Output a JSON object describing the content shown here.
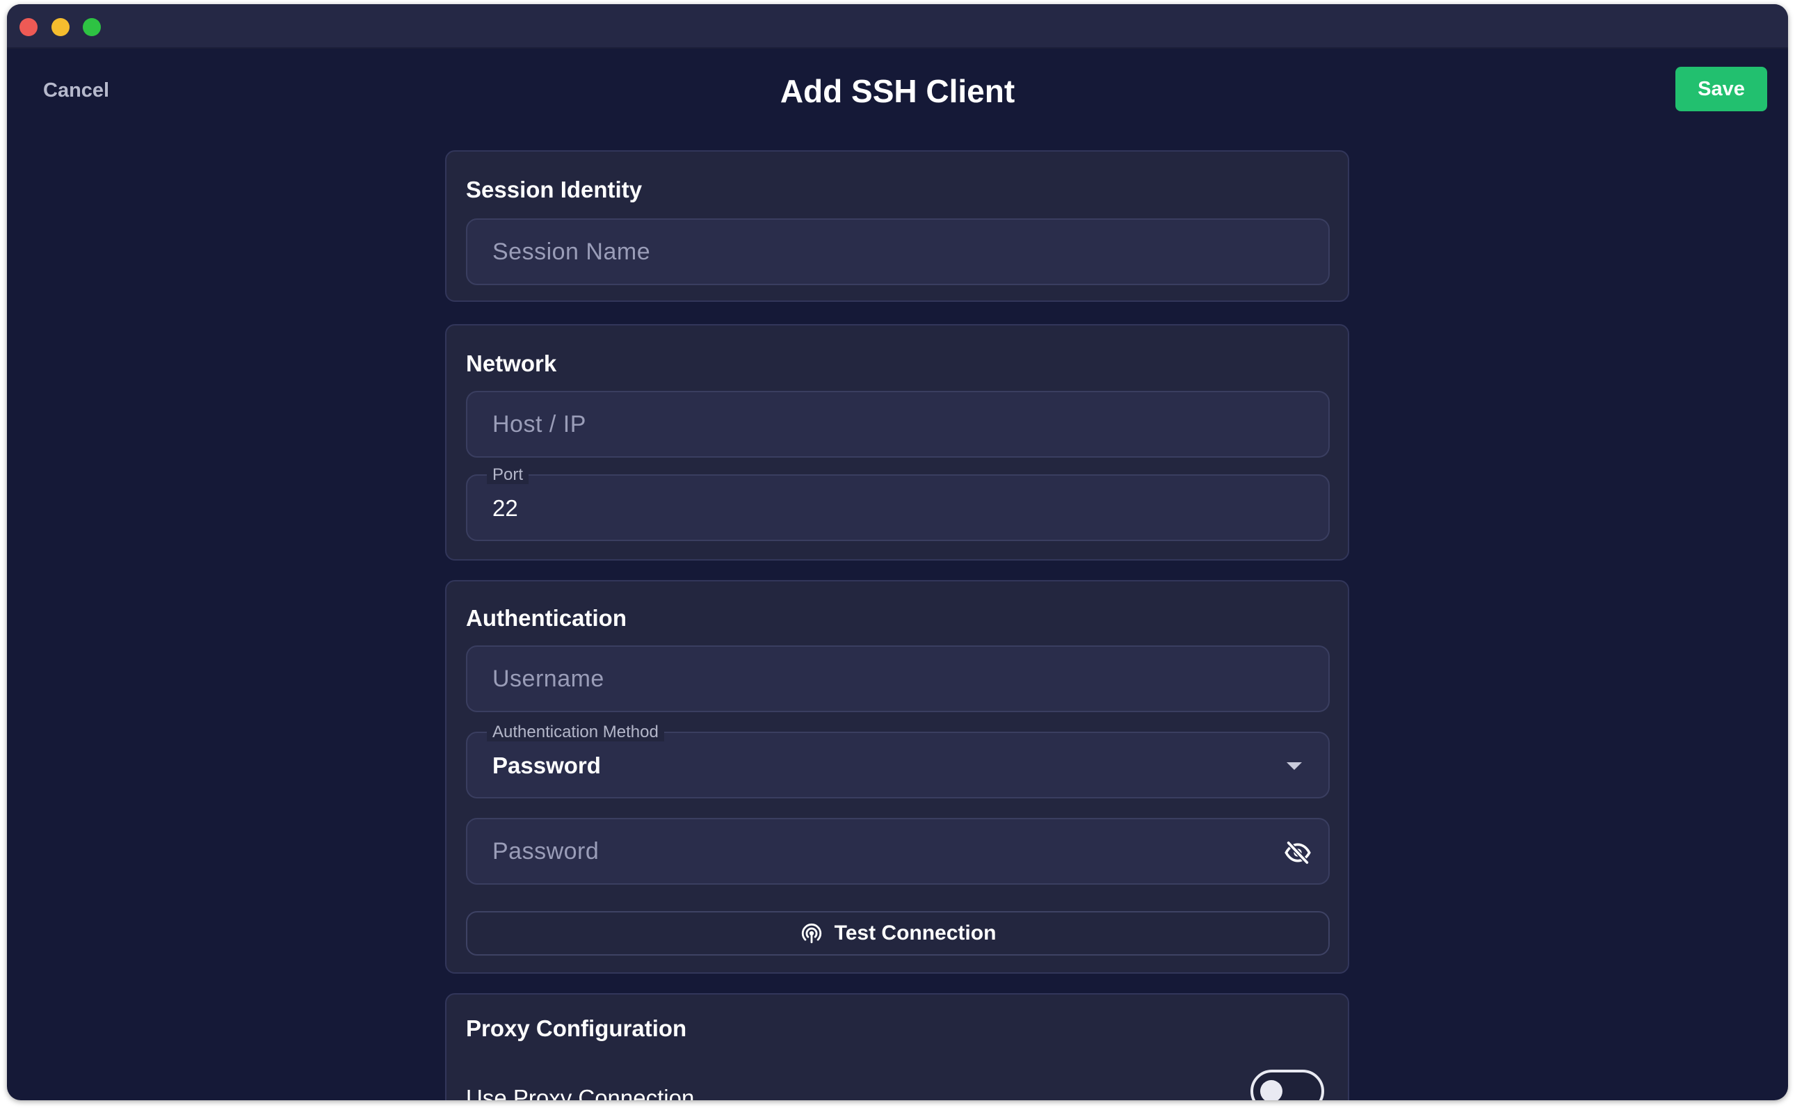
{
  "window": {
    "title_bar_colors": {
      "close": "#ee5a55",
      "minimize": "#f5bd2e",
      "zoom": "#2ec343"
    }
  },
  "header": {
    "cancel_label": "Cancel",
    "title": "Add SSH Client",
    "save_label": "Save",
    "save_color": "#22c06f"
  },
  "session_identity": {
    "title": "Session Identity",
    "session_name_placeholder": "Session Name"
  },
  "network": {
    "title": "Network",
    "host_placeholder": "Host / IP",
    "port_label": "Port",
    "port_value": "22"
  },
  "authentication": {
    "title": "Authentication",
    "username_placeholder": "Username",
    "method_label": "Authentication Method",
    "method_value": "Password",
    "password_placeholder": "Password",
    "password_visibility_icon": "eye-off-icon",
    "test_connection_label": "Test Connection",
    "test_connection_icon": "signal-icon"
  },
  "proxy": {
    "title": "Proxy Configuration",
    "use_proxy_label": "Use Proxy Connection",
    "use_proxy_enabled": false
  }
}
